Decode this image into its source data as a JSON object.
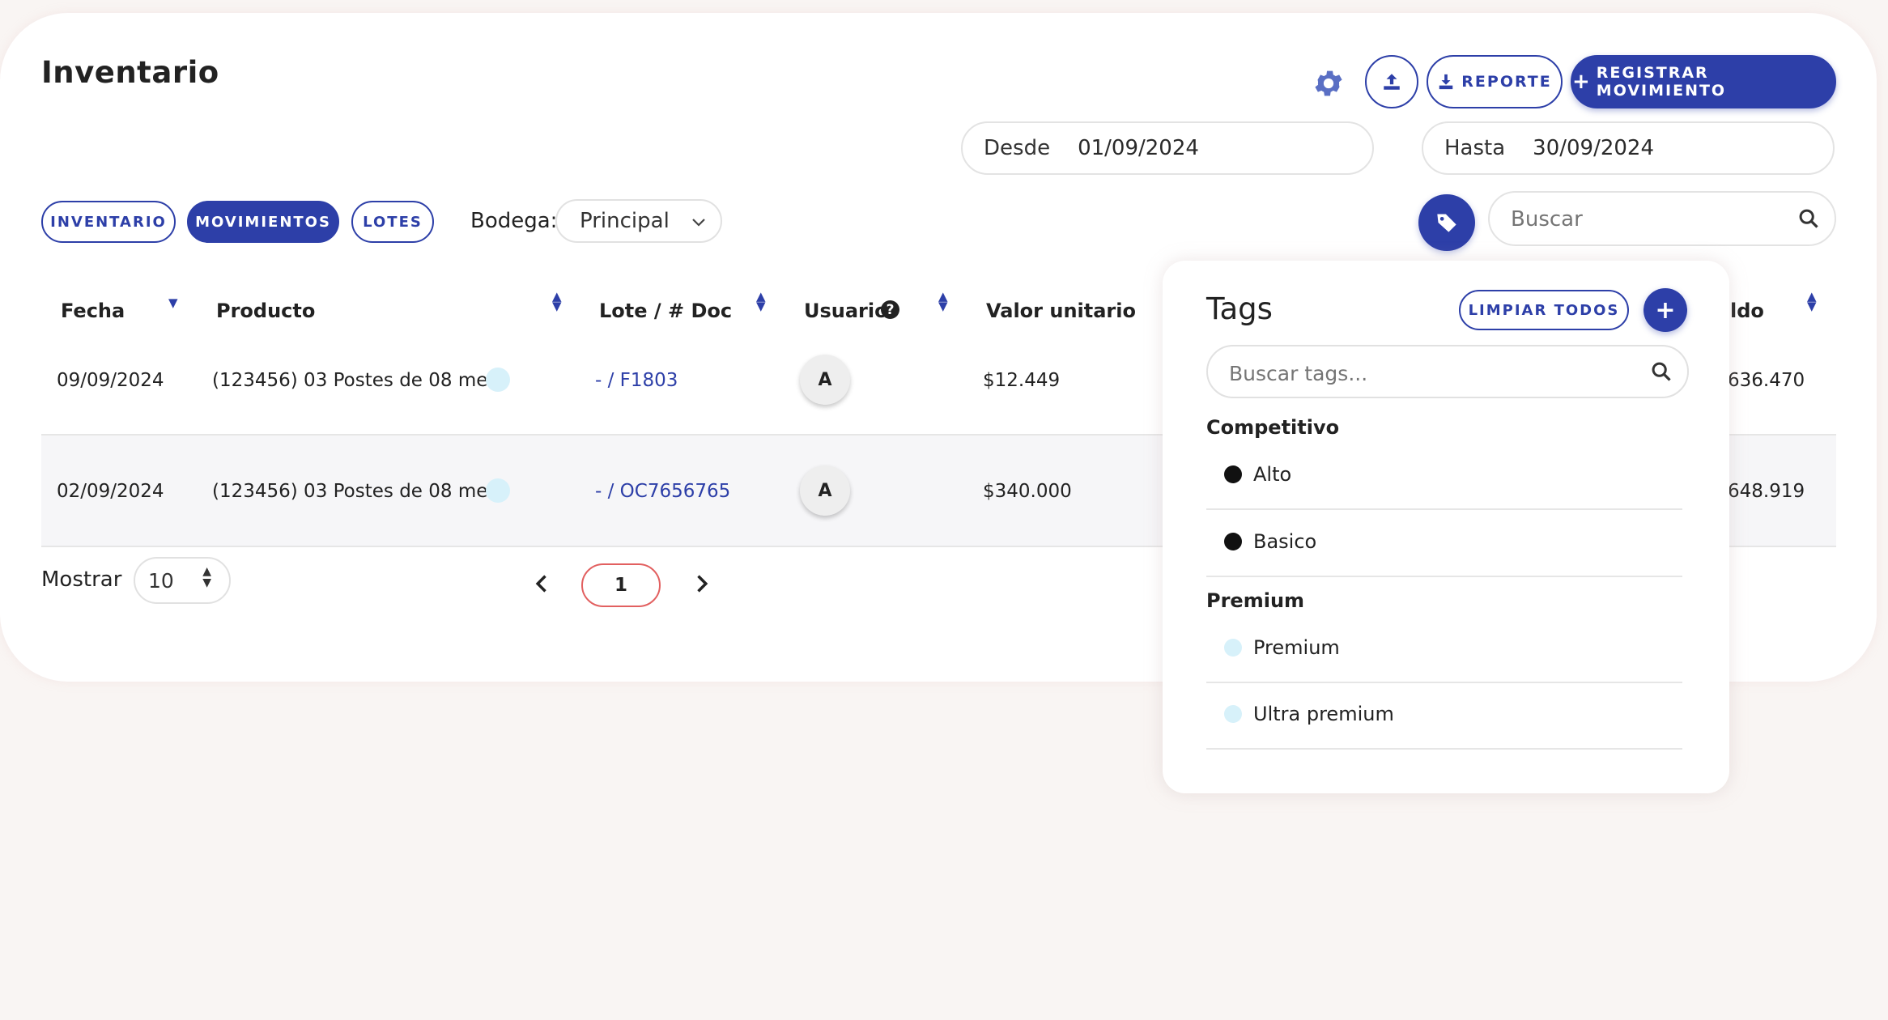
{
  "page": {
    "title": "Inventario"
  },
  "toolbar": {
    "settings_icon": "gear-icon",
    "upload_icon": "upload-icon",
    "report_label": "REPORTE",
    "register_label": "REGISTRAR MOVIMIENTO",
    "accent_color": "#2d3fa8"
  },
  "date_range": {
    "from_label": "Desde",
    "from_value": "01/09/2024",
    "to_label": "Hasta",
    "to_value": "30/09/2024"
  },
  "tabs": [
    {
      "label": "INVENTARIO",
      "active": false
    },
    {
      "label": "MOVIMIENTOS",
      "active": true
    },
    {
      "label": "LOTES",
      "active": false
    }
  ],
  "warehouse": {
    "label": "Bodega:",
    "selected": "Principal"
  },
  "search": {
    "placeholder": "Buscar"
  },
  "table": {
    "headers": {
      "fecha": "Fecha",
      "producto": "Producto",
      "lote": "Lote / # Doc",
      "usuario": "Usuario",
      "valor": "Valor unitario",
      "saldo": "ldo"
    },
    "rows": [
      {
        "fecha": "09/09/2024",
        "producto": "(123456) 03 Postes de 08 me...",
        "lote": "- / F1803",
        "usuario": "A",
        "valor": "$12.449",
        "saldo": "636.470"
      },
      {
        "fecha": "02/09/2024",
        "producto": "(123456) 03 Postes de 08 me...",
        "lote": "- / OC7656765",
        "usuario": "A",
        "valor": "$340.000",
        "saldo": "648.919"
      }
    ]
  },
  "pagination": {
    "show_label": "Mostrar",
    "page_size": "10",
    "current_page": "1"
  },
  "tags_panel": {
    "title": "Tags",
    "clear_label": "LIMPIAR TODOS",
    "add_label": "+",
    "search_placeholder": "Buscar tags...",
    "groups": [
      {
        "name": "Competitivo",
        "items": [
          {
            "label": "Alto",
            "color": "#111111"
          },
          {
            "label": "Basico",
            "color": "#111111"
          }
        ]
      },
      {
        "name": "Premium",
        "items": [
          {
            "label": "Premium",
            "color": "#d7f1fa"
          },
          {
            "label": "Ultra premium",
            "color": "#d7f1fa"
          }
        ]
      }
    ]
  }
}
